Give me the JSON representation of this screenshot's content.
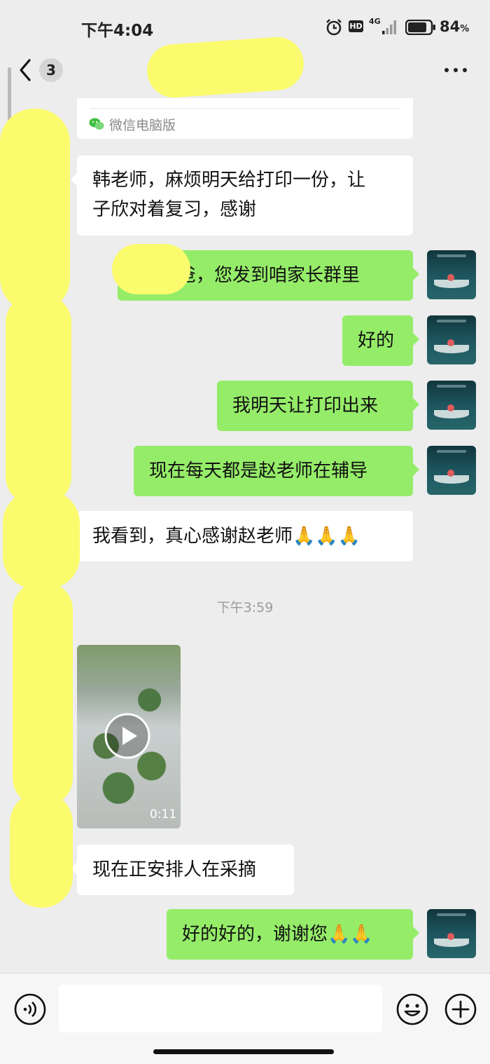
{
  "status_bar": {
    "time": "下午4:04",
    "network": "4G",
    "hd": "HD",
    "battery_percent": "84",
    "battery_unit": "%",
    "battery_level": 0.84
  },
  "nav": {
    "unread_count": "3",
    "back_icon": "chevron-left-icon",
    "more_icon": "more-horizontal-icon"
  },
  "forwarded": {
    "source_label": "微信电脑版"
  },
  "messages": [
    {
      "side": "in",
      "text_lines": [
        "韩老师，麻烦明天给打印一份，让",
        "子欣对着复习，感谢"
      ]
    },
    {
      "side": "out",
      "text": "爸，您发到咱家长群里"
    },
    {
      "side": "out",
      "text": "好的"
    },
    {
      "side": "out",
      "text": "我明天让打印出来"
    },
    {
      "side": "out",
      "text": "现在每天都是赵老师在辅导"
    },
    {
      "side": "in",
      "text": "我看到，真心感谢赵老师🙏🙏🙏"
    },
    {
      "type": "time",
      "text": "下午3:59"
    },
    {
      "side": "in",
      "type": "video",
      "duration": "0:11"
    },
    {
      "side": "in",
      "text": "现在正安排人在采摘"
    },
    {
      "side": "out",
      "text": "好的好的，谢谢您🙏🙏"
    }
  ],
  "input_bar": {
    "input_value": "",
    "icons": [
      "voice-icon",
      "emoji-icon",
      "plus-icon"
    ]
  }
}
